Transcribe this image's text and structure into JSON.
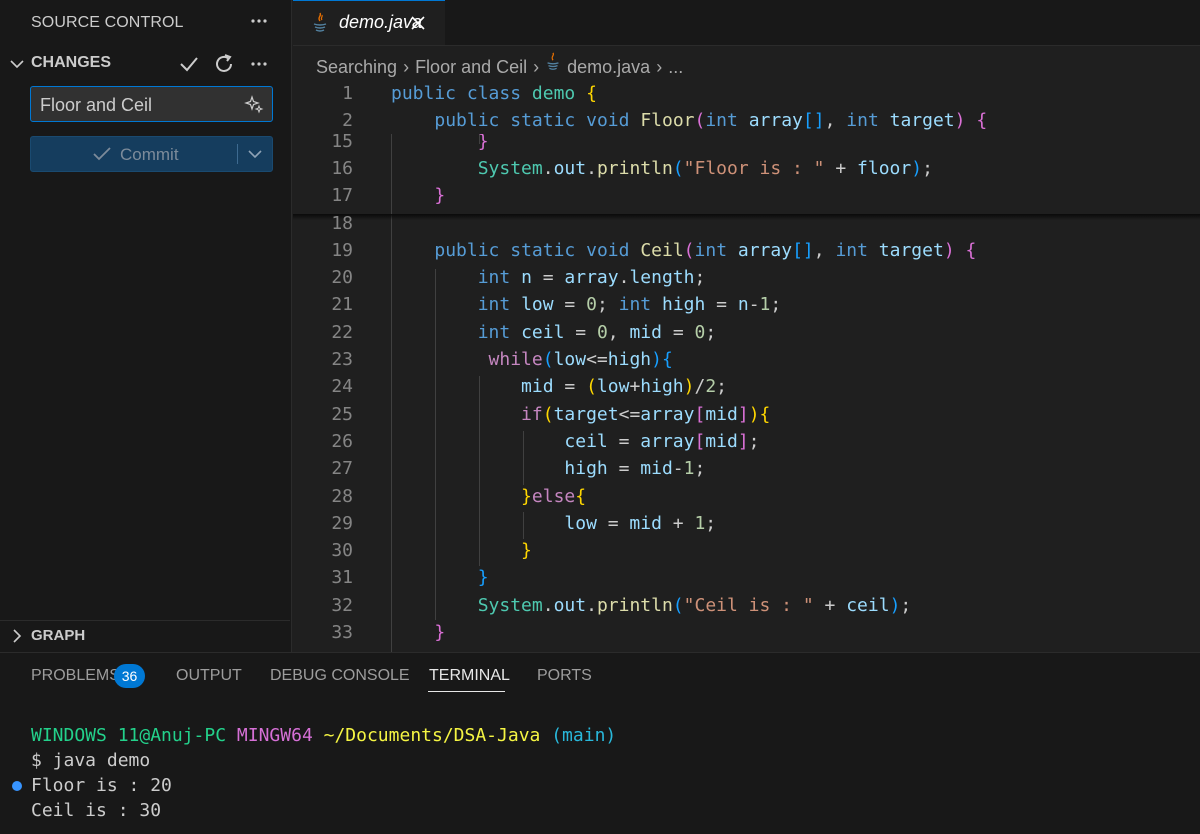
{
  "sidebar": {
    "title": "SOURCE CONTROL",
    "changes_label": "CHANGES",
    "commit_message": "Floor and Ceil",
    "commit_label": "Commit",
    "graph_label": "GRAPH"
  },
  "editor": {
    "tab_label": "demo.java",
    "breadcrumb": [
      "Searching",
      "Floor and Ceil",
      "demo.java",
      "..."
    ],
    "code_lines": [
      {
        "n": "1",
        "t": "public class demo {"
      },
      {
        "n": "2",
        "t": "    public static void Floor(int array[], int target) {"
      },
      {
        "n": "15",
        "t": "        }"
      },
      {
        "n": "16",
        "t": "        System.out.println(\"Floor is : \" + floor);"
      },
      {
        "n": "17",
        "t": "    }"
      },
      {
        "n": "18",
        "t": ""
      },
      {
        "n": "19",
        "t": "    public static void Ceil(int array[], int target) {"
      },
      {
        "n": "20",
        "t": "        int n = array.length;"
      },
      {
        "n": "21",
        "t": "        int low = 0; int high = n-1;"
      },
      {
        "n": "22",
        "t": "        int ceil = 0, mid = 0;"
      },
      {
        "n": "23",
        "t": "         while(low<=high){"
      },
      {
        "n": "24",
        "t": "            mid = (low+high)/2;"
      },
      {
        "n": "25",
        "t": "            if(target<=array[mid]){"
      },
      {
        "n": "26",
        "t": "                ceil = array[mid];"
      },
      {
        "n": "27",
        "t": "                high = mid-1;"
      },
      {
        "n": "28",
        "t": "            }else{"
      },
      {
        "n": "29",
        "t": "                low = mid + 1;"
      },
      {
        "n": "30",
        "t": "            }"
      },
      {
        "n": "31",
        "t": "        }"
      },
      {
        "n": "32",
        "t": "        System.out.println(\"Ceil is : \" + ceil);"
      },
      {
        "n": "33",
        "t": "    }"
      }
    ]
  },
  "panel": {
    "tabs": [
      "PROBLEMS",
      "OUTPUT",
      "DEBUG CONSOLE",
      "TERMINAL",
      "PORTS"
    ],
    "problems_count": "36",
    "active_tab": "TERMINAL"
  },
  "terminal": {
    "user_host": "WINDOWS 11@Anuj-PC",
    "shell": "MINGW64",
    "path": "~/Documents/DSA-Java",
    "branch": "(main)",
    "command": "$ java demo",
    "output": [
      "Floor is : 20",
      "Ceil is : 30"
    ]
  },
  "colors": {
    "accent": "#0078d4",
    "background": "#1f1f1f",
    "sidebar_bg": "#181818"
  }
}
